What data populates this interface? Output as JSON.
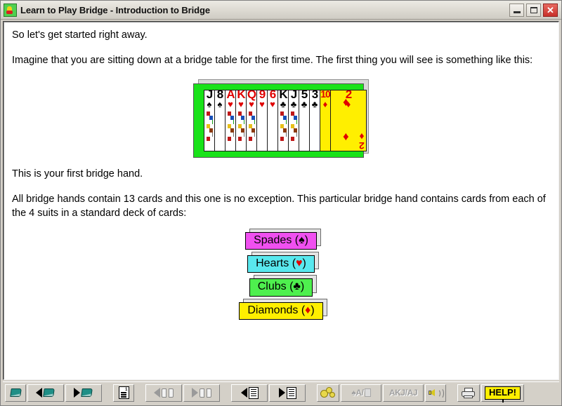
{
  "window": {
    "title": "Learn to Play Bridge - Introduction to Bridge",
    "app_icon": "bridge-app-icon",
    "controls": {
      "minimize": "minimize-button",
      "maximize": "maximize-button",
      "close": "close-button",
      "close_glyph": "✕"
    }
  },
  "content": {
    "paragraph1": "So let's get started right away.",
    "paragraph2": "Imagine that you are sitting down at a bridge table for the first time. The first thing you will see is something like this:",
    "paragraph3": "This is your first bridge hand.",
    "paragraph4": "All bridge hands contain 13 cards and this one is no exception. This particular bridge hand contains cards from each of the 4 suits in a standard deck of cards:"
  },
  "hand": {
    "table_color": "#19e219",
    "highlight_color": "#ffef00",
    "cards": [
      {
        "rank": "J",
        "suit": "♠",
        "color": "black",
        "court": true
      },
      {
        "rank": "8",
        "suit": "♠",
        "color": "black",
        "court": false
      },
      {
        "rank": "A",
        "suit": "♥",
        "color": "red",
        "court": true
      },
      {
        "rank": "K",
        "suit": "♥",
        "color": "red",
        "court": true
      },
      {
        "rank": "Q",
        "suit": "♥",
        "color": "red",
        "court": true
      },
      {
        "rank": "9",
        "suit": "♥",
        "color": "red",
        "court": false
      },
      {
        "rank": "6",
        "suit": "♥",
        "color": "red",
        "court": false
      },
      {
        "rank": "K",
        "suit": "♣",
        "color": "black",
        "court": true
      },
      {
        "rank": "J",
        "suit": "♣",
        "color": "black",
        "court": true
      },
      {
        "rank": "5",
        "suit": "♣",
        "color": "black",
        "court": false
      },
      {
        "rank": "3",
        "suit": "♣",
        "color": "black",
        "court": false
      },
      {
        "rank": "10",
        "suit": "♦",
        "color": "red",
        "court": false
      },
      {
        "rank": "2",
        "suit": "♦",
        "color": "red",
        "court": false
      }
    ],
    "last_card": {
      "rank": "2",
      "suit": "♦",
      "color": "red",
      "pip": "♦"
    }
  },
  "suit_buttons": [
    {
      "label": "Spades (",
      "symbol": "♠",
      "close": ")",
      "color": "#f050f0",
      "sym_color": "black",
      "name": "spades"
    },
    {
      "label": "Hearts (",
      "symbol": "♥",
      "close": ")",
      "color": "#59e8ee",
      "sym_color": "red",
      "name": "hearts"
    },
    {
      "label": "Clubs (",
      "symbol": "♣",
      "close": ")",
      "color": "#4ef04e",
      "sym_color": "black",
      "name": "clubs"
    },
    {
      "label": "Diamonds (",
      "symbol": "♦",
      "close": ")",
      "color": "#ffef00",
      "sym_color": "red",
      "name": "diamonds"
    }
  ],
  "toolbar": {
    "buttons": [
      {
        "name": "contents-book",
        "icon": "book-icon",
        "enabled": true
      },
      {
        "name": "previous-chapter",
        "icon": "back-book-icon",
        "enabled": true
      },
      {
        "name": "next-chapter",
        "icon": "forward-book-icon",
        "enabled": true
      },
      {
        "name": "index",
        "icon": "document-icon",
        "enabled": true
      },
      {
        "name": "previous-topic",
        "icon": "back-open-book-icon",
        "enabled": false
      },
      {
        "name": "next-topic",
        "icon": "forward-open-book-icon",
        "enabled": false
      },
      {
        "name": "previous-page",
        "icon": "back-page-icon",
        "enabled": true
      },
      {
        "name": "next-page",
        "icon": "forward-page-icon",
        "enabled": true
      },
      {
        "name": "options",
        "icon": "gears-icon",
        "enabled": true
      },
      {
        "name": "card-notation",
        "icon": "spade-ace-card-icon",
        "label": "♠A/",
        "enabled": false
      },
      {
        "name": "hand-notation",
        "icon": "akj-aj-icon",
        "label": "AKJ/AJ",
        "enabled": false
      },
      {
        "name": "sound",
        "icon": "speaker-icon",
        "enabled": false
      },
      {
        "name": "print",
        "icon": "printer-icon",
        "enabled": true
      },
      {
        "name": "help",
        "icon": "help-icon",
        "label": "HELP!",
        "enabled": true
      }
    ],
    "help_label": "HELP!",
    "card_notation_label": "♠A/",
    "hand_notation_label": "AKJ/AJ"
  }
}
